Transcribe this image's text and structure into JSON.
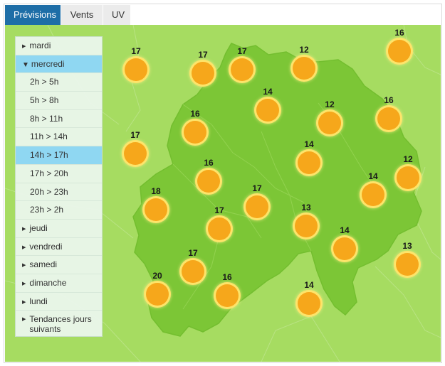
{
  "tabs": [
    {
      "label": "Prévisions",
      "active": true
    },
    {
      "label": "Vents",
      "active": false
    },
    {
      "label": "UV",
      "active": false
    }
  ],
  "menu": {
    "days_before": [
      "mardi"
    ],
    "open_day": "mercredi",
    "slots": [
      "2h > 5h",
      "5h > 8h",
      "8h > 11h",
      "11h > 14h",
      "14h > 17h",
      "17h > 20h",
      "20h > 23h",
      "23h > 2h"
    ],
    "selected_slot": "14h > 17h",
    "days_after": [
      "jeudi",
      "vendredi",
      "samedi",
      "dimanche",
      "lundi"
    ],
    "more_label_line1": "Tendances jours",
    "more_label_line2": "suivants"
  },
  "map": {
    "background_color": "#a6dc61",
    "region_color": "#7cc636",
    "sun_color": "#f6a71b",
    "forecast_icon": "sun-icon",
    "temperatures": [
      "17",
      "17",
      "17",
      "12",
      "16",
      "14",
      "12",
      "16",
      "16",
      "17",
      "14",
      "12",
      "16",
      "14",
      "18",
      "17",
      "17",
      "13",
      "14",
      "13",
      "17",
      "20",
      "16",
      "14"
    ]
  }
}
